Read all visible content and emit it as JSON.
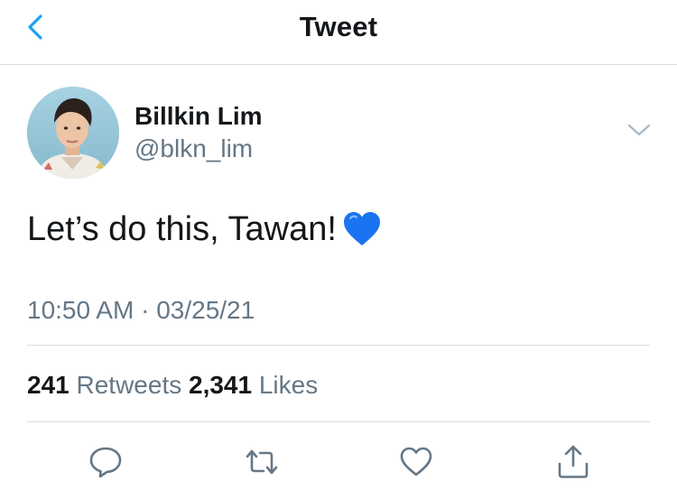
{
  "header": {
    "title": "Tweet",
    "back_icon": "chevron-left-icon"
  },
  "tweet": {
    "author": {
      "name": "Billkin Lim",
      "handle": "@blkn_lim"
    },
    "text": "Let’s do this, Tawan!",
    "emoji": "blue-heart-emoji",
    "time": "10:50 AM",
    "separator": "·",
    "date": "03/25/21",
    "stats": {
      "retweets_count": "241",
      "retweets_label": "Retweets",
      "likes_count": "2,341",
      "likes_label": "Likes"
    }
  },
  "actions": [
    {
      "name": "reply",
      "icon": "reply-icon"
    },
    {
      "name": "retweet",
      "icon": "retweet-icon"
    },
    {
      "name": "like",
      "icon": "heart-icon"
    },
    {
      "name": "share",
      "icon": "share-icon"
    }
  ],
  "colors": {
    "accent": "#1da1f2",
    "text": "#14171a",
    "secondary": "#657786",
    "divider": "#d8dde1",
    "emoji_blue": "#1a73f0"
  }
}
